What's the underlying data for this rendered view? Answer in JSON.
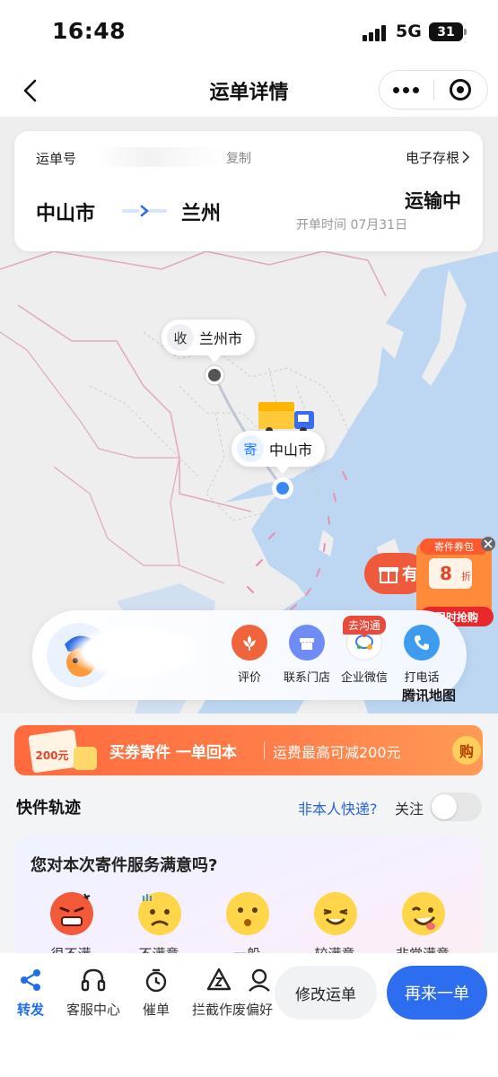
{
  "status_bar": {
    "time": "16:48",
    "network": "5G",
    "battery": "31"
  },
  "nav": {
    "title": "运单详情"
  },
  "order": {
    "no_label": "运单号",
    "copy_label": "复制",
    "archive_label": "电子存根",
    "from_city": "中山市",
    "to_city": "兰州",
    "status": "运输中",
    "open_time": "开单时间 07月31日"
  },
  "map": {
    "recv_badge": "收",
    "recv_city": "兰州市",
    "send_badge": "寄",
    "send_city": "中山市",
    "provider": "腾讯地图"
  },
  "coupon_float": {
    "title": "寄件券包",
    "discount": "8",
    "discount_unit": "折",
    "cta": "限时抢购",
    "tab_text": "有"
  },
  "actions": [
    {
      "label": "评价",
      "icon": "flower-icon",
      "color": "#f0643c"
    },
    {
      "label": "联系门店",
      "icon": "store-icon",
      "color": "#6f8bf5"
    },
    {
      "label": "企业微信",
      "icon": "wecom-icon",
      "color": "#ffffff",
      "badge": "去沟通"
    },
    {
      "label": "打电话",
      "icon": "phone-icon",
      "color": "#3d9bf0"
    }
  ],
  "banner": {
    "coupon_value": "200元",
    "text": "买券寄件 一单回本",
    "sub": "运费最高可减200元",
    "buy": "购"
  },
  "tracking": {
    "label": "快件轨迹",
    "not_me": "非本人快递?",
    "follow": "关注",
    "follow_on": false
  },
  "survey": {
    "question": "您对本次寄件服务满意吗?",
    "options": [
      "很不满",
      "不满意",
      "一般",
      "较满意",
      "非常满意"
    ]
  },
  "bottom": {
    "tabs": [
      {
        "label": "转发",
        "icon": "share-icon",
        "active": true
      },
      {
        "label": "客服中心",
        "icon": "headset-icon",
        "active": false
      },
      {
        "label": "催单",
        "icon": "timer-icon",
        "active": false
      },
      {
        "label": "拦截作废",
        "icon": "intercept-icon",
        "active": false
      },
      {
        "label": "偏好",
        "icon": "preference-icon",
        "active": false
      }
    ],
    "modify_label": "修改运单",
    "again_label": "再来一单"
  },
  "colors": {
    "accent": "#2d6df0",
    "orange": "#ff6a3d",
    "sea": "#bcd7f5",
    "land": "#efefee"
  }
}
